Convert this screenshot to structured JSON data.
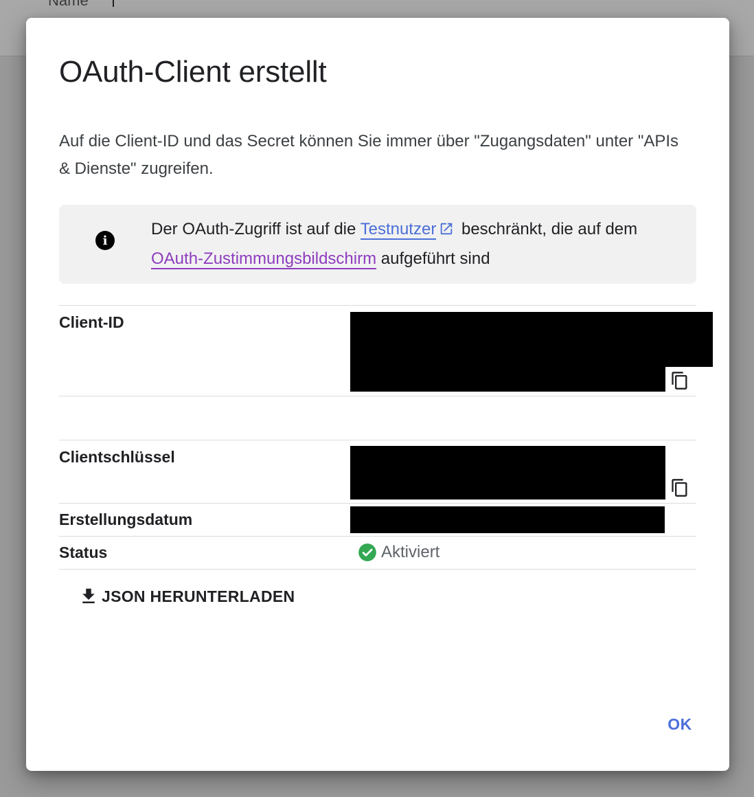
{
  "background": {
    "header_text": "Name"
  },
  "dialog": {
    "title": "OAuth-Client erstellt",
    "description": "Auf die Client-ID und das Secret können Sie immer über \"Zugangsdaten\" unter \"APIs & Dienste\" zugreifen.",
    "info": {
      "icon": "info-icon",
      "text_before": "Der OAuth-Zugriff ist auf die ",
      "link_testnutzer": "Testnutzer",
      "text_middle": " beschränkt, die auf dem ",
      "link_consent": "OAuth-Zustimmungsbildschirm",
      "text_after": " aufgeführt sind"
    },
    "fields": {
      "client_id_label": "Client-ID",
      "client_secret_label": "Clientschlüssel",
      "created_label": "Erstellungsdatum",
      "status_label": "Status",
      "status_value": "Aktiviert"
    },
    "download_label": "JSON HERUNTERLADEN",
    "ok_label": "OK"
  },
  "colors": {
    "link_blue": "#4a6fd8",
    "link_visited": "#8e3cbf",
    "status_green": "#34a853"
  }
}
